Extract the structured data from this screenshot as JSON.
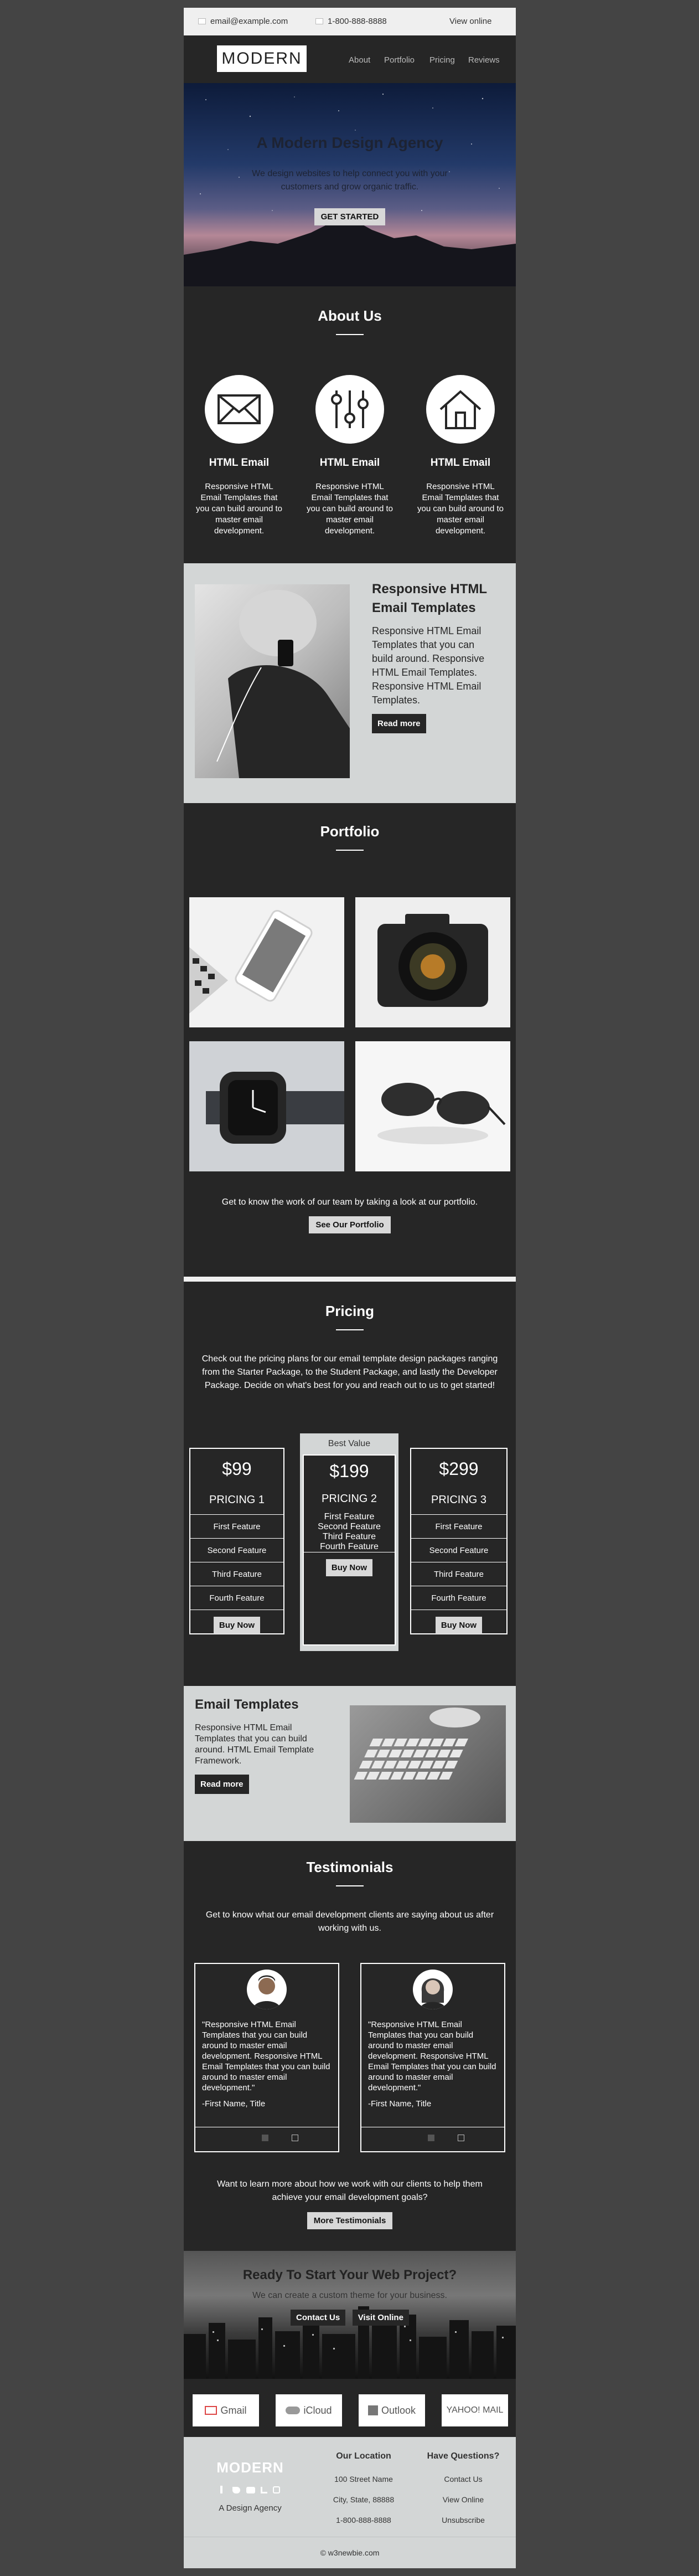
{
  "topbar": {
    "email": "email@example.com",
    "phone": "1-800-888-8888",
    "view_online": "View online"
  },
  "nav": {
    "logo": "MODERN",
    "links": [
      "About",
      "Portfolio",
      "Pricing",
      "Reviews"
    ]
  },
  "hero": {
    "title": "A Modern Design Agency",
    "subtitle": "We design websites to help connect you with your customers and grow organic traffic.",
    "button": "GET STARTED"
  },
  "about": {
    "title": "About Us",
    "features": [
      {
        "icon": "envelope-icon",
        "title": "HTML Email",
        "text": "Responsive HTML Email Templates that you can build around to master email development."
      },
      {
        "icon": "sliders-icon",
        "title": "HTML Email",
        "text": "Responsive HTML Email Templates that you can build around to master email development."
      },
      {
        "icon": "house-icon",
        "title": "HTML Email",
        "text": "Responsive HTML Email Templates that you can build around to master email development."
      }
    ]
  },
  "info": {
    "title": "Responsive HTML Email Templates",
    "text": "Responsive HTML Email Templates that you can build around. Responsive HTML Email Templates. Responsive HTML Email Templates.",
    "button": "Read more"
  },
  "portfolio": {
    "title": "Portfolio",
    "caption": "Get to know the work of our team by taking a look at our portfolio.",
    "button": "See Our Portfolio"
  },
  "pricing": {
    "title": "Pricing",
    "intro": "Check out the pricing plans for our email template design packages ranging from the Starter Package, to the Student Package, and lastly the Developer Package. Decide on what's best for you and reach out to us to get started!",
    "best_value": "Best Value",
    "plans": [
      {
        "price": "$99",
        "name": "PRICING 1",
        "features": [
          "First Feature",
          "Second Feature",
          "Third Feature",
          "Fourth Feature"
        ],
        "button": "Buy Now"
      },
      {
        "price": "$199",
        "name": "PRICING 2",
        "features": [
          "First Feature",
          "Second Feature",
          "Third Feature",
          "Fourth Feature"
        ],
        "button": "Buy Now"
      },
      {
        "price": "$299",
        "name": "PRICING 3",
        "features": [
          "First Feature",
          "Second Feature",
          "Third Feature",
          "Fourth Feature"
        ],
        "button": "Buy Now"
      }
    ]
  },
  "promo": {
    "title": "Email Templates",
    "text": "Responsive HTML Email Templates that you can build around. HTML Email Template Framework.",
    "button": "Read more"
  },
  "testimonials": {
    "title": "Testimonials",
    "intro": "Get to know what our email development clients are saying about us after working with us.",
    "cards": [
      {
        "quote": "\"Responsive HTML Email Templates that you can build around to master email development. Responsive HTML Email Templates that you can build around to master email development.\"",
        "author": "-First Name, Title"
      },
      {
        "quote": "\"Responsive HTML Email Templates that you can build around to master email development. Responsive HTML Email Templates that you can build around to master email development.\"",
        "author": "-First Name, Title"
      }
    ],
    "outro": "Want to learn more about how we work with our clients to help them achieve your email development goals?",
    "button": "More Testimonials"
  },
  "cta": {
    "title": "Ready To Start Your Web Project?",
    "subtitle": "We can create a custom theme for your business.",
    "contact_button": "Contact Us",
    "visit_button": "Visit Online"
  },
  "partners": [
    "Gmail",
    "iCloud",
    "Outlook",
    "YAHOO! MAIL"
  ],
  "footer": {
    "logo": "MODERN",
    "tagline": "A Design Agency",
    "location_title": "Our Location",
    "address1": "100 Street Name",
    "address2": "City, State, 88888",
    "phone": "1-800-888-8888",
    "questions_title": "Have Questions?",
    "links": [
      "Contact Us",
      "View Online",
      "Unsubscribe"
    ],
    "copyright": "© w3newbie.com"
  }
}
